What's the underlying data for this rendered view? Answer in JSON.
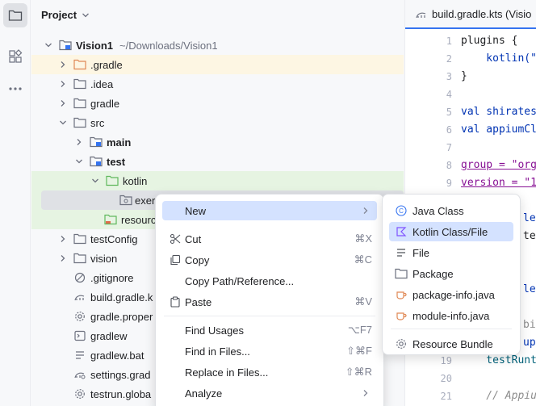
{
  "toolstrip": {
    "items": [
      {
        "name": "project-tool-icon",
        "active": true
      },
      {
        "name": "structure-tool-icon",
        "active": false
      },
      {
        "name": "more-tools-icon",
        "active": false
      }
    ]
  },
  "project": {
    "title": "Project",
    "tree": [
      {
        "label": "Vision1",
        "hint": "~/Downloads/Vision1",
        "bold": true
      },
      {
        "label": ".gradle",
        "bold": false
      },
      {
        "label": ".idea",
        "bold": false
      },
      {
        "label": "gradle",
        "bold": false
      },
      {
        "label": "src",
        "bold": false
      },
      {
        "label": "main",
        "bold": true
      },
      {
        "label": "test",
        "bold": true
      },
      {
        "label": "kotlin",
        "bold": false
      },
      {
        "label": "exer",
        "bold": false
      },
      {
        "label": "resourc",
        "bold": false
      },
      {
        "label": "testConfig",
        "bold": false
      },
      {
        "label": "vision",
        "bold": false
      },
      {
        "label": ".gitignore",
        "bold": false
      },
      {
        "label": "build.gradle.k",
        "bold": false
      },
      {
        "label": "gradle.proper",
        "bold": false
      },
      {
        "label": "gradlew",
        "bold": false
      },
      {
        "label": "gradlew.bat",
        "bold": false
      },
      {
        "label": "settings.grad",
        "bold": false
      },
      {
        "label": "testrun.globa",
        "bold": false
      }
    ]
  },
  "editor": {
    "tab_label": "build.gradle.kts (Visio",
    "line_numbers": [
      "1",
      "2",
      "3",
      "4",
      "5",
      "6",
      "7",
      "8",
      "9",
      "10",
      "11",
      "12",
      "13",
      "14",
      "15",
      "16",
      "17",
      "18",
      "19",
      "20",
      "21"
    ],
    "lines": [
      "plugins {",
      "    kotlin(\"",
      "}",
      "",
      "val shirates",
      "val appiumCl",
      "",
      "group = \"org",
      "version = \"1",
      "",
      "",
      "",
      "",
      "",
      "",
      "",
      "",
      "",
      "    testRunt",
      "",
      "    // Appiu"
    ],
    "partial_lines": [
      "les",
      "ten",
      "les",
      "bit",
      "upl"
    ]
  },
  "context_menu": {
    "items": [
      {
        "label": "New",
        "shortcut": "",
        "submenu": true
      },
      {
        "label": "Cut",
        "shortcut": "⌘X"
      },
      {
        "label": "Copy",
        "shortcut": "⌘C"
      },
      {
        "label": "Copy Path/Reference...",
        "shortcut": ""
      },
      {
        "label": "Paste",
        "shortcut": "⌘V"
      },
      {
        "label": "Find Usages",
        "shortcut": "⌥F7"
      },
      {
        "label": "Find in Files...",
        "shortcut": "⇧⌘F"
      },
      {
        "label": "Replace in Files...",
        "shortcut": "⇧⌘R"
      },
      {
        "label": "Analyze",
        "shortcut": "",
        "submenu": true
      }
    ]
  },
  "submenu": {
    "items": [
      {
        "label": "Java Class"
      },
      {
        "label": "Kotlin Class/File"
      },
      {
        "label": "File"
      },
      {
        "label": "Package"
      },
      {
        "label": "package-info.java"
      },
      {
        "label": "module-info.java"
      },
      {
        "label": "Resource Bundle"
      }
    ]
  },
  "colors": {
    "accent": "#3574f0",
    "selection": "#d4e2ff",
    "gradle_row": "#fdf6e3",
    "test_row": "#e6f4e2"
  }
}
